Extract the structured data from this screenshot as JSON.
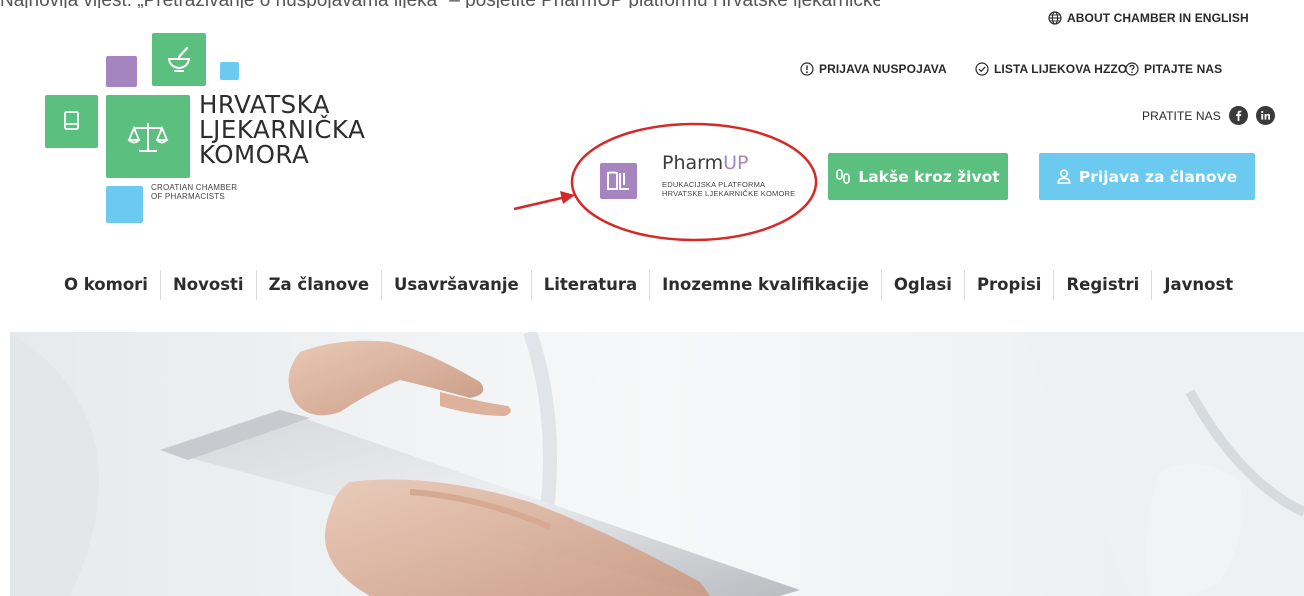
{
  "caption": "Najnovija vijest: „Pretraživanje o nuspojavama lijeka\" – posjetite PharmUP platformu Hrvatske ljekarničke komore i saznajte",
  "header": {
    "english_link": "ABOUT CHAMBER IN ENGLISH",
    "utility_links": [
      "PRIJAVA NUSPOJAVA",
      "LISTA LIJEKOVA HZZO",
      "PITAJTE NAS"
    ],
    "follow_label": "PRATITE NAS"
  },
  "logo": {
    "line1": "HRVATSKA",
    "line2": "LJEKARNIČKA",
    "line3": "KOMORA",
    "sub1": "CROATIAN CHAMBER",
    "sub2": "OF PHARMACISTS"
  },
  "pharmup": {
    "title_main": "Pharm",
    "title_accent": "UP",
    "sub1": "EDUKACIJSKA PLATFORMA",
    "sub2": "HRVATSKE LJEKARNIČKE KOMORE"
  },
  "buttons": {
    "life": "Lakše kroz život",
    "members": "Prijava za članove"
  },
  "nav": [
    "O komori",
    "Novosti",
    "Za članove",
    "Usavršavanje",
    "Literatura",
    "Inozemne kvalifikacije",
    "Oglasi",
    "Propisi",
    "Registri",
    "Javnost"
  ],
  "colors": {
    "green": "#5bbf7f",
    "blue": "#6ccaf0",
    "purple": "#a584bf",
    "annotation_red": "#d62828"
  }
}
